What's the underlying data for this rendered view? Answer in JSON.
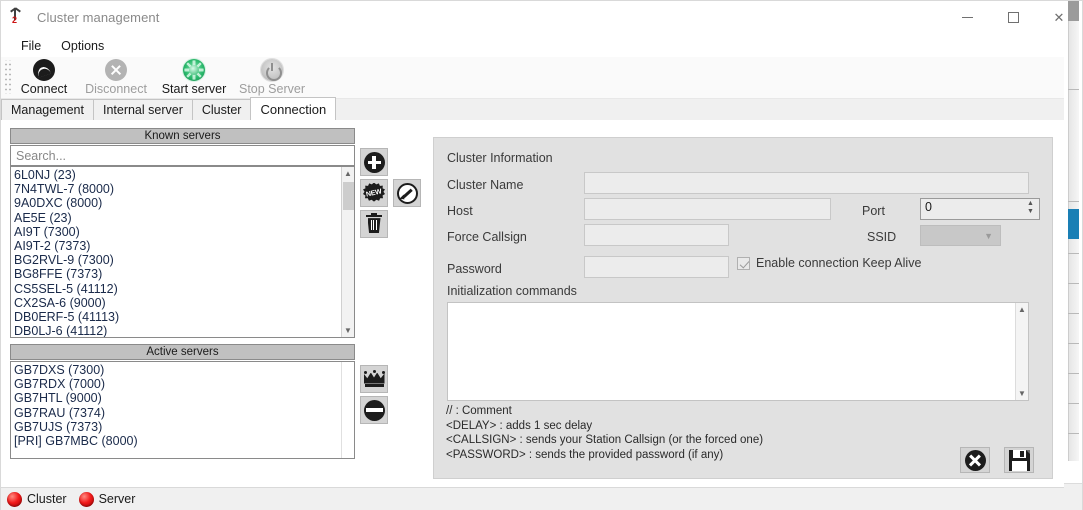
{
  "window": {
    "title": "Cluster management",
    "icon": "antenna-icon",
    "controls": {
      "minimize": "minimize-icon",
      "maximize": "maximize-icon",
      "close": "close-icon"
    }
  },
  "menu": {
    "items": [
      "File",
      "Options"
    ]
  },
  "toolbar": {
    "buttons": [
      {
        "label": "Connect",
        "icon": "connect-icon",
        "enabled": true
      },
      {
        "label": "Disconnect",
        "icon": "disconnect-icon",
        "enabled": false
      },
      {
        "label": "Start server",
        "icon": "start-server-icon",
        "enabled": true
      },
      {
        "label": "Stop Server",
        "icon": "stop-server-icon",
        "enabled": false
      }
    ]
  },
  "tabs": {
    "items": [
      "Management",
      "Internal server",
      "Cluster",
      "Connection"
    ],
    "active": "Connection"
  },
  "known_servers": {
    "title": "Known servers",
    "search_placeholder": "Search...",
    "search_value": "",
    "items": [
      "6L0NJ (23)",
      "7N4TWL-7 (8000)",
      "9A0DXC (8000)",
      "AE5E (23)",
      "AI9T (7300)",
      "AI9T-2 (7373)",
      "BG2RVL-9 (7300)",
      "BG8FFE (7373)",
      "CS5SEL-5 (41112)",
      "CX2SA-6 (9000)",
      "DB0ERF-5 (41113)",
      "DB0LJ-6 (41112)"
    ],
    "buttons": [
      {
        "name": "add-server-button",
        "icon": "plus-circle-icon"
      },
      {
        "name": "new-server-button",
        "icon": "new-badge-icon"
      },
      {
        "name": "edit-server-button",
        "icon": "edit-pencil-icon"
      },
      {
        "name": "delete-server-button",
        "icon": "trash-icon"
      }
    ]
  },
  "active_servers": {
    "title": "Active servers",
    "items": [
      "GB7DXS (7300)",
      "GB7RDX (7000)",
      "GB7HTL (9000)",
      "GB7RAU (7374)",
      "GB7UJS (7373)",
      "[PRI] GB7MBC (8000)"
    ],
    "buttons": [
      {
        "name": "set-primary-button",
        "icon": "crown-icon"
      },
      {
        "name": "remove-active-button",
        "icon": "minus-circle-icon"
      }
    ]
  },
  "cluster_information": {
    "title": "Cluster Information",
    "fields": {
      "cluster_name_label": "Cluster Name",
      "cluster_name_value": "",
      "host_label": "Host",
      "host_value": "",
      "port_label": "Port",
      "port_value": "0",
      "force_callsign_label": "Force Callsign",
      "force_callsign_value": "",
      "ssid_label": "SSID",
      "ssid_value": "",
      "password_label": "Password",
      "password_value": "",
      "keepalive_label": "Enable connection Keep Alive",
      "keepalive_checked": true,
      "init_commands_label": "Initialization commands",
      "init_commands_value": ""
    },
    "legend": "// : Comment\n<DELAY> : adds 1 sec delay\n<CALLSIGN> : sends your Station Callsign (or the forced one)\n<PASSWORD> : sends the provided password (if any)",
    "actions": [
      {
        "name": "cancel-button",
        "icon": "cancel-icon"
      },
      {
        "name": "save-button",
        "icon": "floppy-save-icon"
      }
    ]
  },
  "statusbar": {
    "indicators": [
      {
        "label": "Cluster",
        "state_color": "#f21b1b"
      },
      {
        "label": "Server",
        "state_color": "#f21b1b"
      }
    ]
  }
}
